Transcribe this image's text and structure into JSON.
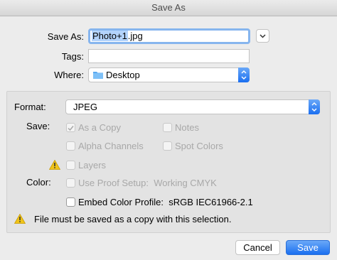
{
  "window": {
    "title": "Save As"
  },
  "save_as": {
    "label": "Save As:",
    "filename_selected": "Photo+1",
    "filename_ext": ".jpg"
  },
  "tags": {
    "label": "Tags:",
    "value": ""
  },
  "where": {
    "label": "Where:",
    "value": "Desktop",
    "icon": "folder-icon"
  },
  "format": {
    "label": "Format:",
    "value": "JPEG"
  },
  "save_options": {
    "label": "Save:",
    "as_a_copy": {
      "label": "As a Copy",
      "checked": true,
      "enabled": false
    },
    "notes": {
      "label": "Notes",
      "checked": false,
      "enabled": false
    },
    "alpha_channels": {
      "label": "Alpha Channels",
      "checked": false,
      "enabled": false
    },
    "spot_colors": {
      "label": "Spot Colors",
      "checked": false,
      "enabled": false
    },
    "layers": {
      "label": "Layers",
      "checked": false,
      "enabled": false
    }
  },
  "color": {
    "label": "Color:",
    "use_proof_setup": {
      "label": "Use Proof Setup:",
      "profile": "Working CMYK",
      "checked": false,
      "enabled": false
    },
    "embed_profile": {
      "label": "Embed Color Profile:",
      "profile": "sRGB IEC61966-2.1",
      "checked": false,
      "enabled": true
    }
  },
  "warning": {
    "message": "File must be saved as a copy with this selection.",
    "icon": "warning-icon"
  },
  "buttons": {
    "cancel": "Cancel",
    "save": "Save"
  },
  "colors": {
    "accent": "#1b6ff0",
    "warning": "#f0c419",
    "focus_ring": "#86b5ee"
  }
}
